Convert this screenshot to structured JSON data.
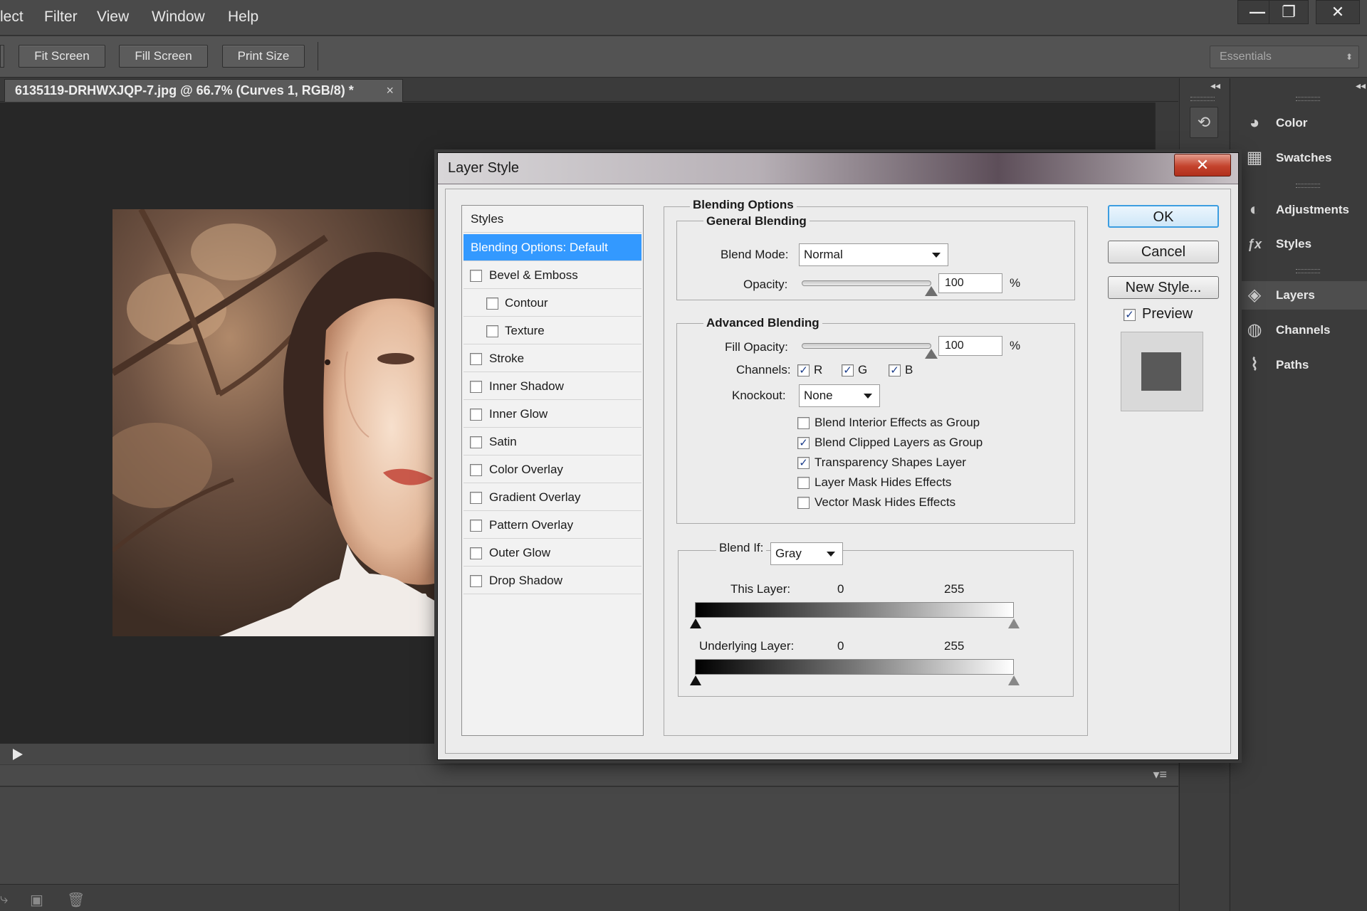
{
  "menu": [
    "lect",
    "Filter",
    "View",
    "Window",
    "Help"
  ],
  "window_controls": [
    "—",
    "❐",
    "✕"
  ],
  "options_bar": {
    "buttons": [
      "Fit Screen",
      "Fill Screen",
      "Print Size"
    ],
    "workspace": "Essentials",
    "workspace_arrows": "⬍"
  },
  "document": {
    "tab_title": "6135119-DRHWXJQP-7.jpg @ 66.7% (Curves 1, RGB/8) *",
    "close_glyph": "×"
  },
  "right_dock": {
    "collapse_left": "◂◂",
    "collapse_right": "◂◂",
    "history_icon": "⟲",
    "panels": [
      {
        "label": "Color",
        "icon": "palette-icon",
        "glyph": "◕"
      },
      {
        "label": "Swatches",
        "icon": "swatches-grid-icon",
        "glyph": "▦"
      },
      {
        "label": "Adjustments",
        "icon": "adjustments-icon",
        "glyph": "◐"
      },
      {
        "label": "Styles",
        "icon": "styles-fx-icon",
        "glyph": "ƒx"
      },
      {
        "label": "Layers",
        "icon": "layers-icon",
        "glyph": "◈"
      },
      {
        "label": "Channels",
        "icon": "channels-icon",
        "glyph": "◍"
      },
      {
        "label": "Paths",
        "icon": "paths-icon",
        "glyph": "⌇"
      }
    ]
  },
  "timeline": {
    "menu_glyph": "▾≡"
  },
  "dialog": {
    "title": "Layer Style",
    "close_glyph": "✕",
    "styles": {
      "header": "Styles",
      "items": [
        {
          "label": "Blending Options: Default",
          "selected": true,
          "checkbox": false
        },
        {
          "label": "Bevel & Emboss",
          "checkbox": true,
          "checked": false
        },
        {
          "label": "Contour",
          "checkbox": true,
          "checked": false,
          "indent": true
        },
        {
          "label": "Texture",
          "checkbox": true,
          "checked": false,
          "indent": true
        },
        {
          "label": "Stroke",
          "checkbox": true,
          "checked": false
        },
        {
          "label": "Inner Shadow",
          "checkbox": true,
          "checked": false
        },
        {
          "label": "Inner Glow",
          "checkbox": true,
          "checked": false
        },
        {
          "label": "Satin",
          "checkbox": true,
          "checked": false
        },
        {
          "label": "Color Overlay",
          "checkbox": true,
          "checked": false
        },
        {
          "label": "Gradient Overlay",
          "checkbox": true,
          "checked": false
        },
        {
          "label": "Pattern Overlay",
          "checkbox": true,
          "checked": false
        },
        {
          "label": "Outer Glow",
          "checkbox": true,
          "checked": false
        },
        {
          "label": "Drop Shadow",
          "checkbox": true,
          "checked": false
        }
      ]
    },
    "blending_options": {
      "title": "Blending Options",
      "general": {
        "title": "General Blending",
        "blend_mode_label": "Blend Mode:",
        "blend_mode_value": "Normal",
        "opacity_label": "Opacity:",
        "opacity_value": "100",
        "opacity_fraction": 1.0,
        "percent": "%"
      },
      "advanced": {
        "title": "Advanced Blending",
        "fill_opacity_label": "Fill Opacity:",
        "fill_opacity_value": "100",
        "fill_opacity_fraction": 1.0,
        "percent": "%",
        "channels_label": "Channels:",
        "channels": [
          {
            "label": "R",
            "checked": true
          },
          {
            "label": "G",
            "checked": true
          },
          {
            "label": "B",
            "checked": true
          }
        ],
        "knockout_label": "Knockout:",
        "knockout_value": "None",
        "options": [
          {
            "label": "Blend Interior Effects as Group",
            "checked": false
          },
          {
            "label": "Blend Clipped Layers as Group",
            "checked": true
          },
          {
            "label": "Transparency Shapes Layer",
            "checked": true
          },
          {
            "label": "Layer Mask Hides Effects",
            "checked": false
          },
          {
            "label": "Vector Mask Hides Effects",
            "checked": false
          }
        ]
      },
      "blend_if": {
        "label": "Blend If:",
        "value": "Gray",
        "this_layer_label": "This Layer:",
        "this_layer_min": "0",
        "this_layer_max": "255",
        "underlying_label": "Underlying Layer:",
        "underlying_min": "0",
        "underlying_max": "255"
      }
    },
    "buttons": {
      "ok": "OK",
      "cancel": "Cancel",
      "new_style": "New Style...",
      "preview_label": "Preview",
      "preview_checked": true
    },
    "check_glyph": "✓"
  }
}
